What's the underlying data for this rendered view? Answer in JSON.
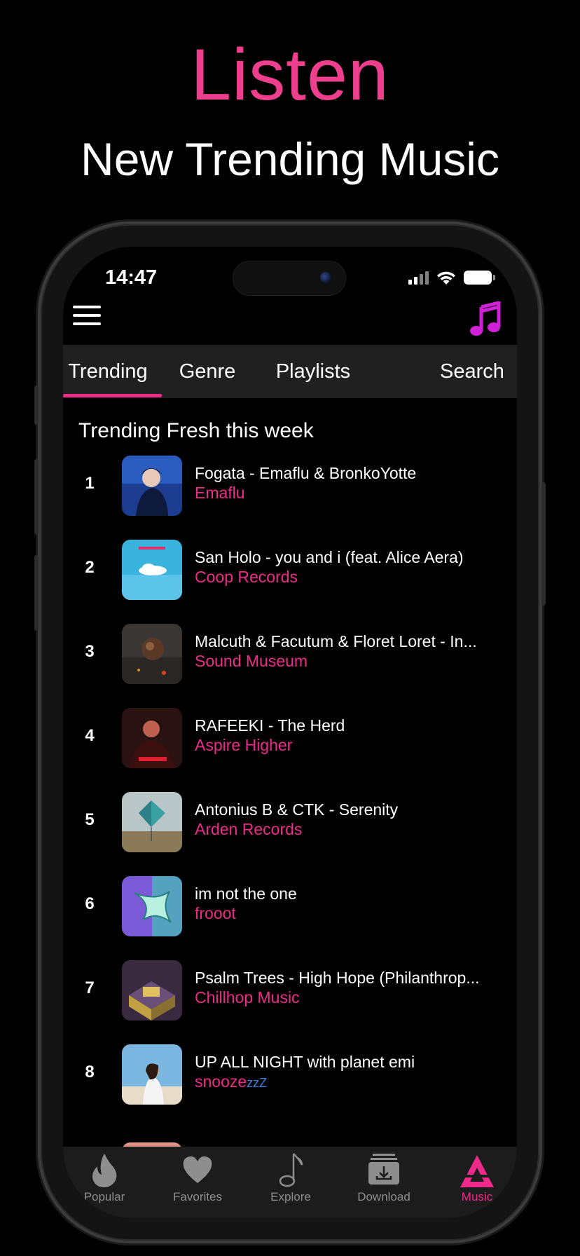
{
  "promo": {
    "title": "Listen",
    "subtitle": "New Trending Music"
  },
  "status_bar": {
    "time": "14:47"
  },
  "header": {
    "menu_icon": "hamburger-menu-icon",
    "app_icon": "music-note-icon"
  },
  "tabs": [
    {
      "label": "Trending",
      "active": true
    },
    {
      "label": "Genre",
      "active": false
    },
    {
      "label": "Playlists",
      "active": false
    },
    {
      "label": "Search",
      "active": false
    }
  ],
  "section": {
    "title": "Trending Fresh this week"
  },
  "tracks": [
    {
      "rank": "1",
      "title": "Fogata - Emaflu & BronkoYotte",
      "artist": "Emaflu"
    },
    {
      "rank": "2",
      "title": "San Holo - you and i (feat. Alice Aera)",
      "artist": "Coop Records"
    },
    {
      "rank": "3",
      "title": "Malcuth & Facutum & Floret Loret - In...",
      "artist": "Sound Museum"
    },
    {
      "rank": "4",
      "title": "RAFEEKI - The Herd",
      "artist": "Aspire Higher"
    },
    {
      "rank": "5",
      "title": "Antonius B & CTK - Serenity",
      "artist": "Arden Records"
    },
    {
      "rank": "6",
      "title": "im not the one",
      "artist": "frooot"
    },
    {
      "rank": "7",
      "title": "Psalm Trees - High Hope (Philanthrop...",
      "artist": "Chillhop Music"
    },
    {
      "rank": "8",
      "title": "UP ALL NIGHT with planet emi",
      "artist": "snooze",
      "artist_suffix": "zzZ"
    }
  ],
  "bottom_nav": [
    {
      "label": "Popular",
      "icon": "flame-icon",
      "active": false
    },
    {
      "label": "Favorites",
      "icon": "heart-icon",
      "active": false
    },
    {
      "label": "Explore",
      "icon": "music-note-icon",
      "active": false
    },
    {
      "label": "Download",
      "icon": "download-tray-icon",
      "active": false
    },
    {
      "label": "Music",
      "icon": "music-logo-icon",
      "active": true
    }
  ],
  "colors": {
    "accent": "#ee2a8a",
    "promo_title": "#ee3f8e",
    "background": "#000000",
    "inactive_nav": "#8e8e8e"
  }
}
